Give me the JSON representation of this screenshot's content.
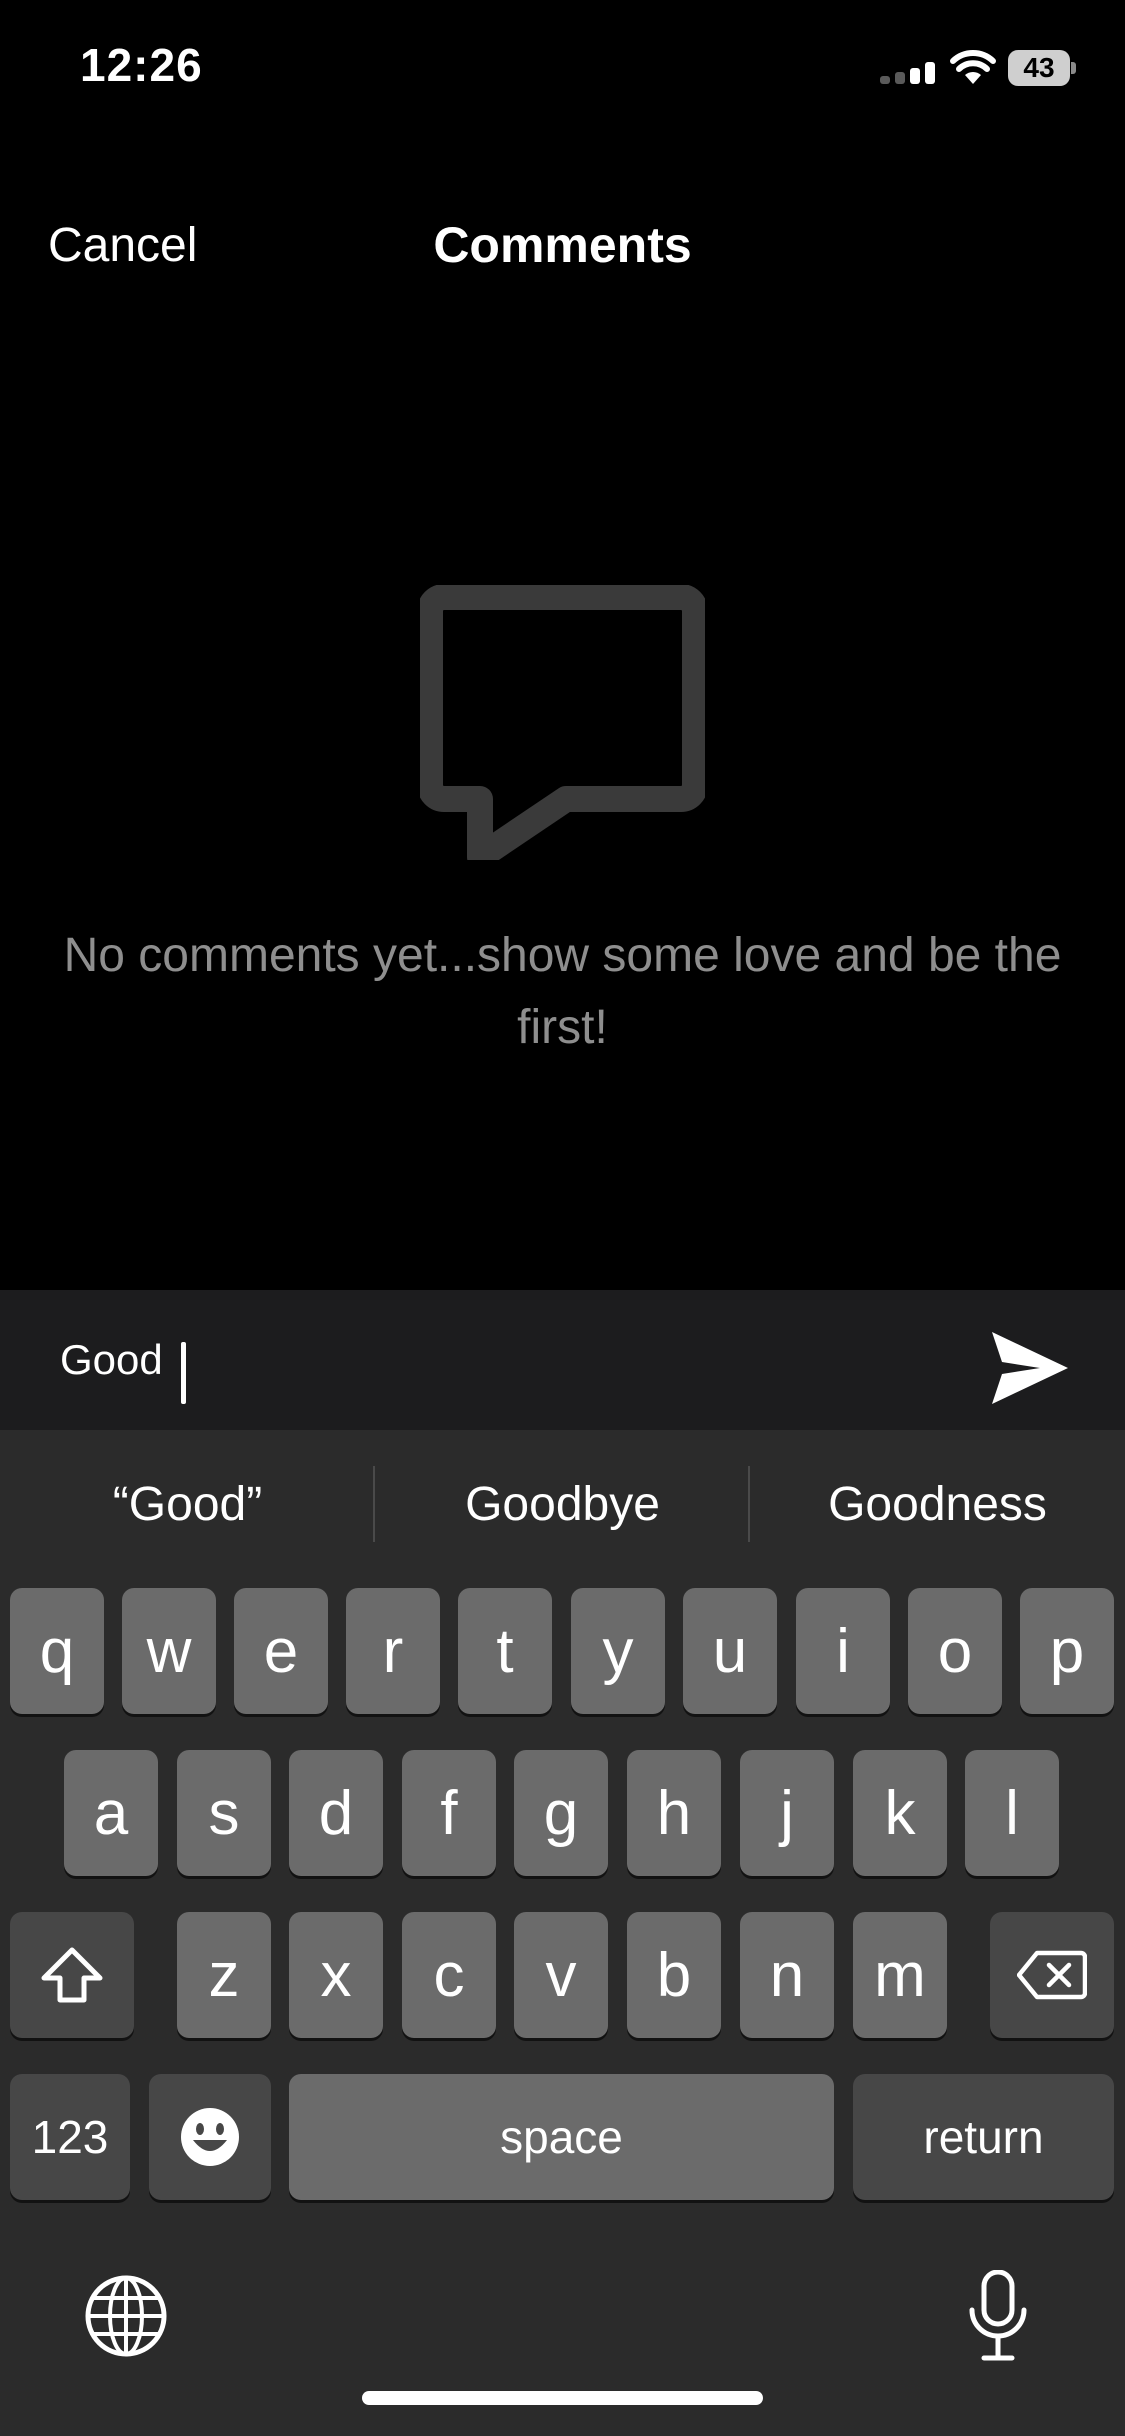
{
  "status_bar": {
    "time": "12:26",
    "battery": "43"
  },
  "nav": {
    "cancel_label": "Cancel",
    "title": "Comments"
  },
  "empty_state": {
    "icon": "chat-bubble-icon",
    "message": "No comments yet...show some love and be the first!"
  },
  "composer": {
    "value": "Good",
    "send_icon": "send-icon"
  },
  "keyboard": {
    "suggestions": [
      "“Good”",
      "Goodbye",
      "Goodness"
    ],
    "row1": [
      "q",
      "w",
      "e",
      "r",
      "t",
      "y",
      "u",
      "i",
      "o",
      "p"
    ],
    "row2": [
      "a",
      "s",
      "d",
      "f",
      "g",
      "h",
      "j",
      "k",
      "l"
    ],
    "row3": [
      "z",
      "x",
      "c",
      "v",
      "b",
      "n",
      "m"
    ],
    "numbers_label": "123",
    "space_label": "space",
    "return_label": "return",
    "icons": {
      "shift": "shift-icon",
      "delete": "backspace-icon",
      "emoji": "emoji-icon",
      "globe": "globe-icon",
      "mic": "microphone-icon"
    }
  },
  "colors": {
    "background": "#000000",
    "composer": "#1c1c1e",
    "keyboard": "#2b2b2b",
    "key": "#6b6b6b",
    "key_dark": "#474747",
    "muted_text": "#8e8e8e"
  }
}
